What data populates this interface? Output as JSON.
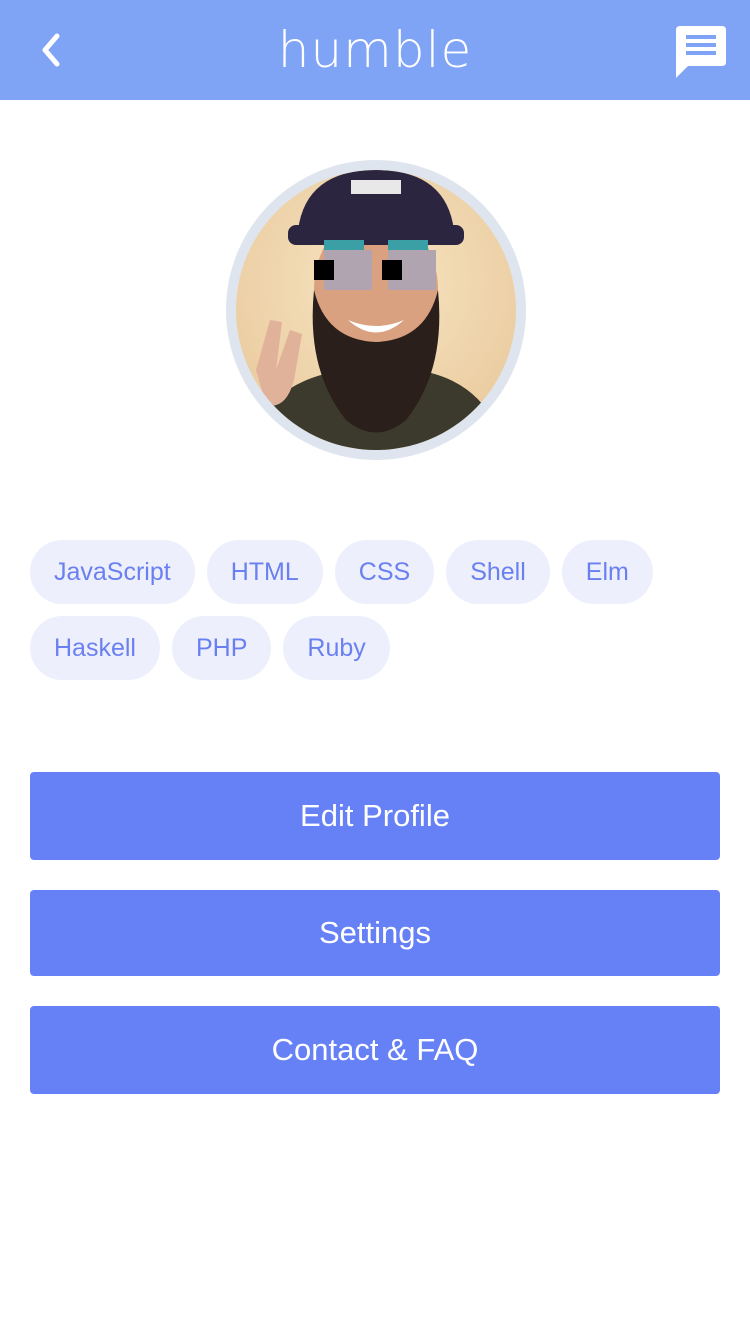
{
  "header": {
    "title": "humble",
    "back_icon": "chevron-left-icon",
    "chat_icon": "message-icon",
    "background": "#7fa3f5"
  },
  "profile": {
    "avatar": "profile-photo"
  },
  "tags": {
    "row1": [
      "JavaScript",
      "HTML",
      "CSS",
      "Shell",
      "Elm"
    ],
    "row2": [
      "Haskell",
      "PHP",
      "Ruby"
    ]
  },
  "buttons": {
    "edit_profile": "Edit Profile",
    "settings": "Settings",
    "contact_faq": "Contact & FAQ",
    "color": "#6680f6"
  }
}
